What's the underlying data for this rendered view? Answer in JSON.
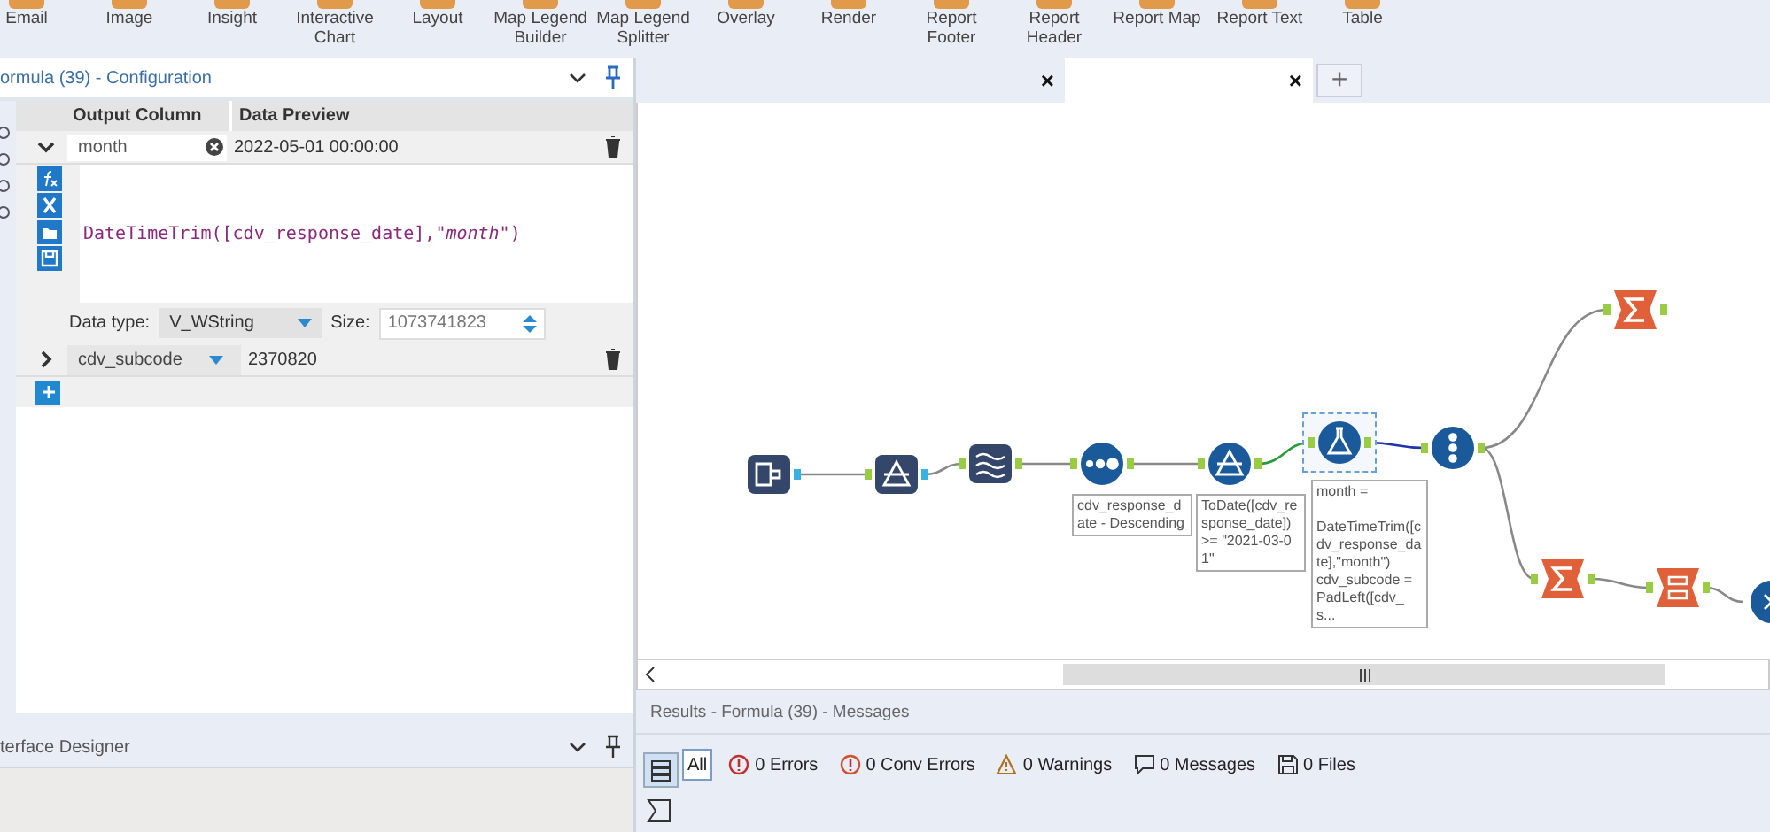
{
  "ribbon": {
    "tools": [
      "Email",
      "Image",
      "Insight",
      "Interactive Chart",
      "Layout",
      "Map Legend Builder",
      "Map Legend Splitter",
      "Overlay",
      "Render",
      "Report Footer",
      "Report Header",
      "Report Map",
      "Report Text",
      "Table"
    ]
  },
  "config_panel": {
    "title": "ormula (39) - Configuration",
    "columns": [
      "Output Column",
      "Data Preview"
    ],
    "rows": [
      {
        "name": "month",
        "preview": "2022-05-01 00:00:00",
        "expanded": true,
        "expression": "DateTimeTrim([cdv_response_date],*\"month\"*)",
        "data_type_label": "Data type:",
        "data_type": "V_WString",
        "size_label": "Size:",
        "size": "1073741823"
      },
      {
        "name": "cdv_subcode",
        "preview": "2370820",
        "expanded": false
      }
    ]
  },
  "designer_panel": {
    "title": "terface Designer"
  },
  "canvas_tabs": [
    {
      "close": "×",
      "selected": false
    },
    {
      "close": "×",
      "selected": true
    }
  ],
  "add_tab": "+",
  "workflow": {
    "nodes": [
      {
        "kind": "input",
        "selected": false
      },
      {
        "kind": "select",
        "selected": false
      },
      {
        "kind": "sample",
        "selected": false
      },
      {
        "kind": "sort",
        "selected": false,
        "annotation": "cdv_response_date - Descending"
      },
      {
        "kind": "filter",
        "selected": false,
        "annotation": "ToDate([cdv_response_date]) >= \"2021-03-01\""
      },
      {
        "kind": "formula",
        "selected": true,
        "annotation": "month =\n\nDateTimeTrim([cdv_response_date],\"month\")\ncdv_subcode = PadLeft([cdv_s..."
      },
      {
        "kind": "recordid",
        "selected": false
      },
      {
        "kind": "summarize",
        "selected": false
      },
      {
        "kind": "summarize",
        "selected": false
      },
      {
        "kind": "crosstab",
        "selected": false
      },
      {
        "kind": "circle",
        "selected": false
      }
    ]
  },
  "results": {
    "title": "Results - Formula (39) - Messages",
    "filters": [
      {
        "kind": "all",
        "label": "All",
        "selected": true
      },
      {
        "kind": "error",
        "label": "0 Errors",
        "selected": false
      },
      {
        "kind": "conv",
        "label": "0 Conv Errors",
        "selected": false
      },
      {
        "kind": "warning",
        "label": "0 Warnings",
        "selected": false
      },
      {
        "kind": "message",
        "label": "0 Messages",
        "selected": false
      },
      {
        "kind": "file",
        "label": "0 Files",
        "selected": false
      }
    ]
  }
}
